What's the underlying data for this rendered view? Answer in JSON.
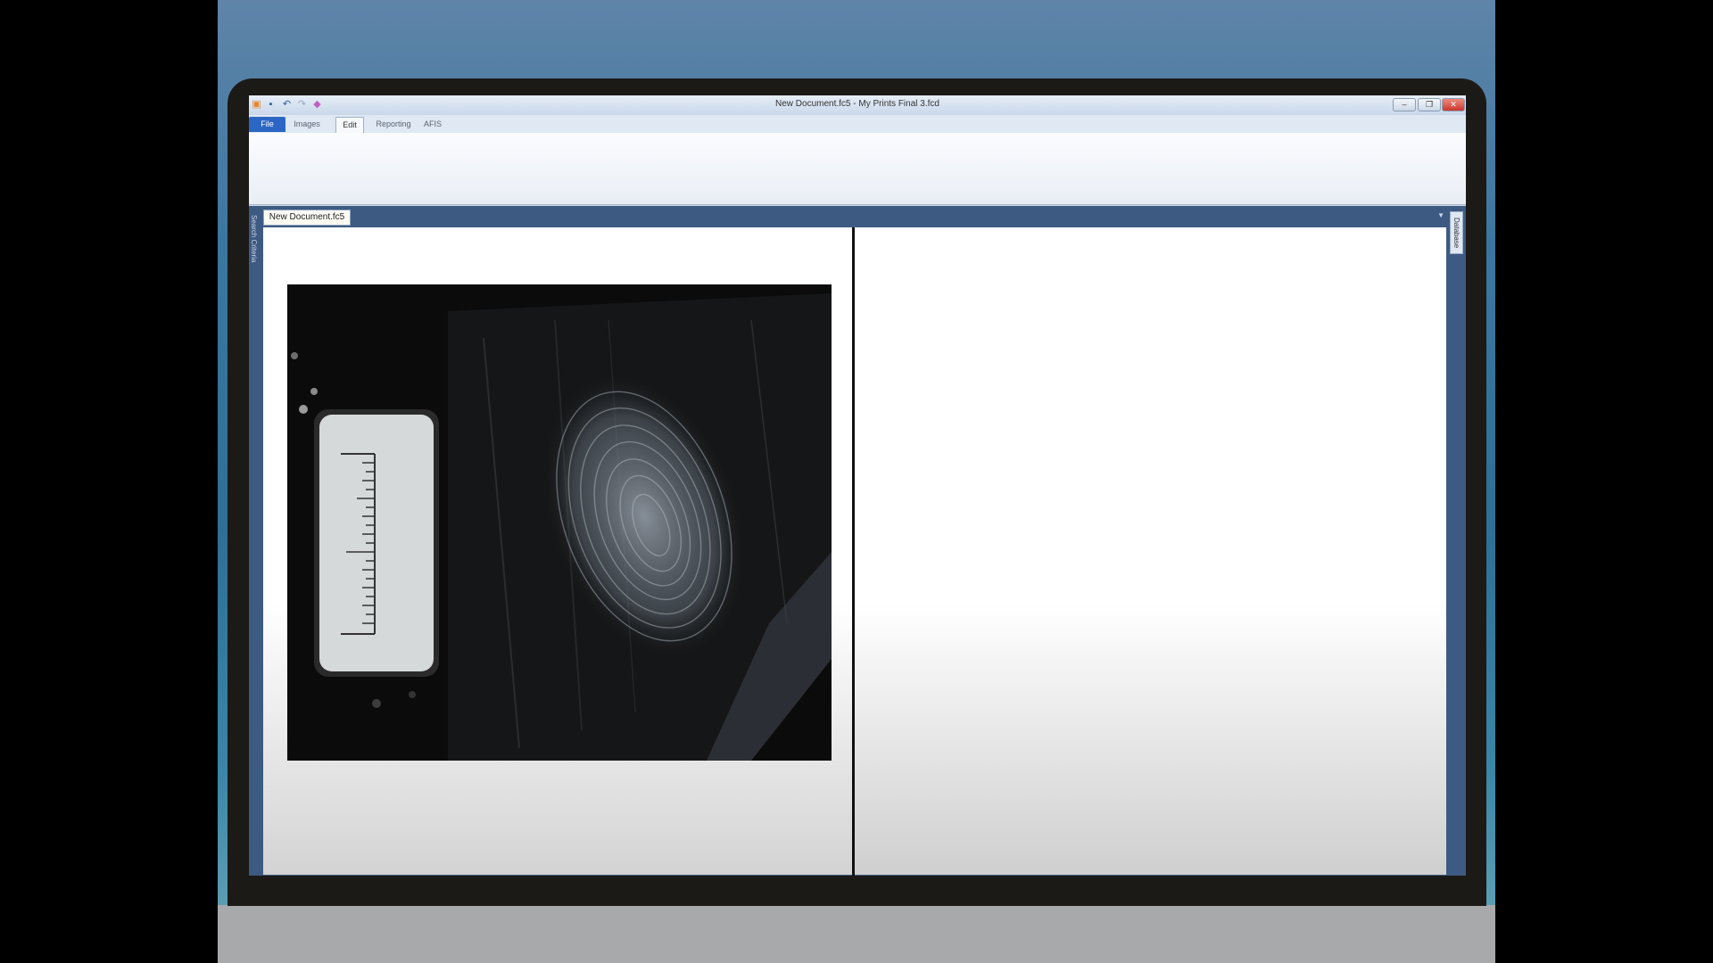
{
  "window": {
    "title": "New Document.fc5 - My Prints Final 3.fcd",
    "controls": {
      "minimize_icon": "minimize-icon",
      "restore_icon": "restore-icon",
      "close_icon": "close-icon"
    }
  },
  "quick_access": [
    "app-icon",
    "save-icon",
    "undo-icon",
    "redo-icon",
    "customize-icon"
  ],
  "ribbon": {
    "tabs": [
      {
        "label": "File",
        "active": false
      },
      {
        "label": "Images",
        "active": false
      },
      {
        "label": "Edit",
        "active": true
      },
      {
        "label": "Reporting",
        "active": false
      },
      {
        "label": "AFIS",
        "active": false
      }
    ]
  },
  "side_panels": {
    "left_label": "Search Criteria",
    "right_label": "Database"
  },
  "document": {
    "tab_label": "New Document.fc5"
  },
  "colors": {
    "file_tab": "#2b66c4",
    "doc_area": "#3d5a82",
    "close_button": "#d9534f"
  }
}
